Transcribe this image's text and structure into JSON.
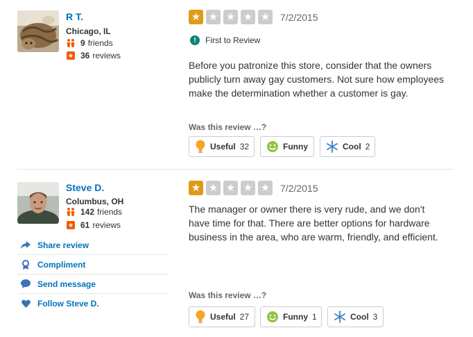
{
  "reviews": [
    {
      "user": {
        "name": "R T.",
        "location": "Chicago, IL",
        "friends_count": "9",
        "friends_label": "friends",
        "reviews_count": "36",
        "reviews_label": "reviews"
      },
      "rating": 1,
      "date": "7/2/2015",
      "badge": "First to Review",
      "text": "Before you patronize this store, consider that the owners publicly turn away gay customers. Not sure how employees make the determination whether a customer is gay.",
      "vote_prompt": "Was this review …?",
      "votes": {
        "useful_label": "Useful",
        "useful_count": "32",
        "funny_label": "Funny",
        "funny_count": "",
        "cool_label": "Cool",
        "cool_count": "2"
      }
    },
    {
      "user": {
        "name": "Steve D.",
        "location": "Columbus, OH",
        "friends_count": "142",
        "friends_label": "friends",
        "reviews_count": "61",
        "reviews_label": "reviews"
      },
      "rating": 1,
      "date": "7/2/2015",
      "text": "The manager or owner there is very rude, and we don't have time for that. There are better options for hardware business in the area, who are warm, friendly, and efficient.",
      "vote_prompt": "Was this review …?",
      "votes": {
        "useful_label": "Useful",
        "useful_count": "27",
        "funny_label": "Funny",
        "funny_count": "1",
        "cool_label": "Cool",
        "cool_count": "3"
      },
      "actions": [
        "Share review",
        "Compliment",
        "Send message",
        "Follow Steve D."
      ]
    }
  ],
  "colors": {
    "link": "#0073bb",
    "star_on": "#e09a17",
    "star_off": "#cccccc",
    "review_badge": "#f15c00",
    "first_badge": "#0c8577"
  },
  "icons": {
    "friends": "friends-icon",
    "reviews": "review-star-icon",
    "useful": "lightbulb-icon",
    "funny": "smiley-icon",
    "cool": "snowflake-icon",
    "share": "share-arrow-icon",
    "compliment": "ribbon-icon",
    "message": "speech-bubble-icon",
    "follow": "heart-icon"
  }
}
